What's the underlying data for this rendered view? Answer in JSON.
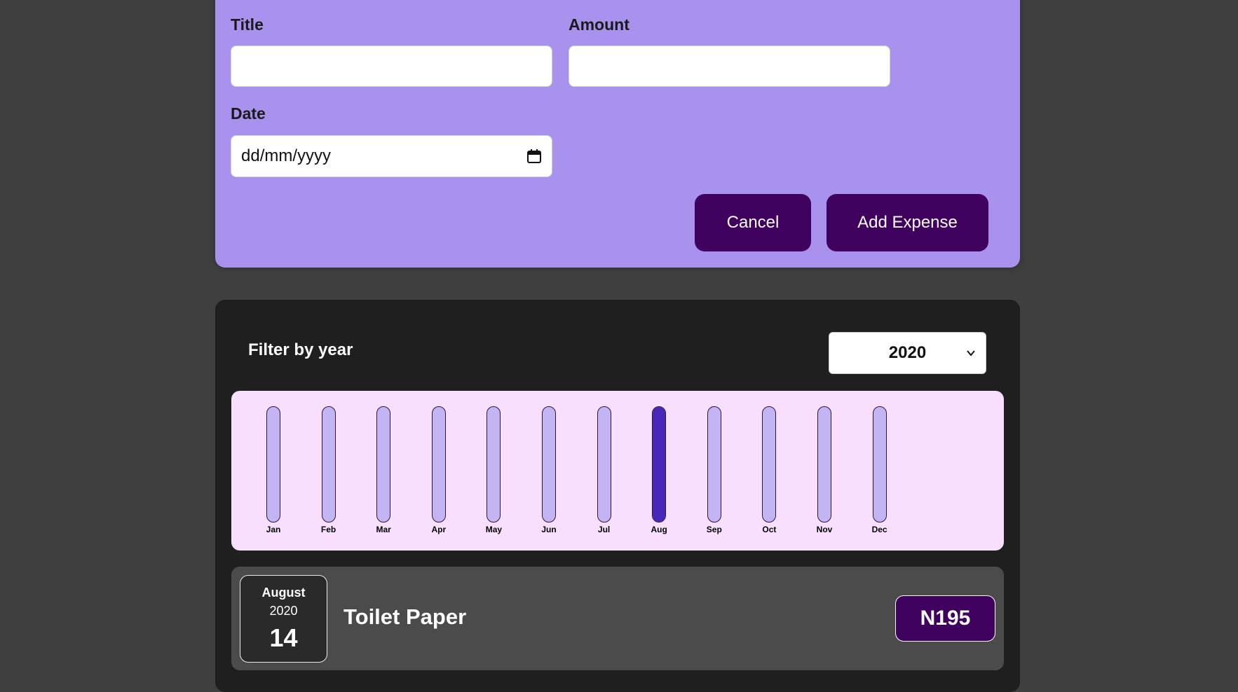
{
  "form": {
    "title_label": "Title",
    "amount_label": "Amount",
    "date_label": "Date",
    "title_value": "",
    "amount_value": "",
    "date_placeholder": "dd/mm/yyyy",
    "cancel_label": "Cancel",
    "submit_label": "Add Expense"
  },
  "filter": {
    "label": "Filter by year",
    "selected_year": "2020"
  },
  "chart_data": {
    "type": "bar",
    "categories": [
      "Jan",
      "Feb",
      "Mar",
      "Apr",
      "May",
      "Jun",
      "Jul",
      "Aug",
      "Sep",
      "Oct",
      "Nov",
      "Dec"
    ],
    "values": [
      0,
      0,
      0,
      0,
      0,
      0,
      0,
      195,
      0,
      0,
      0,
      0
    ],
    "ylim": [
      0,
      195
    ],
    "title": "",
    "xlabel": "",
    "ylabel": ""
  },
  "expenses": [
    {
      "month": "August",
      "year": "2020",
      "day": "14",
      "title": "Toilet Paper",
      "amount": "N195"
    }
  ],
  "colors": {
    "form_bg": "#a892ee",
    "button_bg": "#40005d",
    "chart_bg": "#f8dffd",
    "bar_track": "#c3b4f3",
    "bar_fill": "#4826b9"
  }
}
